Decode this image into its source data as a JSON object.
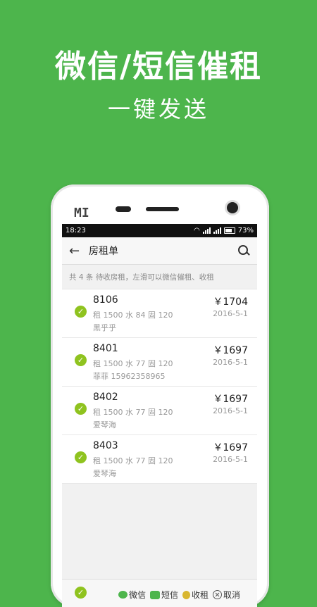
{
  "promo": {
    "headline": "微信/短信催租",
    "subline": "一键发送"
  },
  "phone": {
    "brand_logo": "MI"
  },
  "statusbar": {
    "time": "18:23",
    "battery": "73%"
  },
  "navbar": {
    "back_icon": "back-arrow-icon",
    "title": "房租单",
    "search_icon": "search-icon"
  },
  "summary": "共 4 条 待收房租，左滑可以微信催租、收租",
  "rows": [
    {
      "room": "8106",
      "detail": "租 1500 水 84 固 120",
      "tenant": "黑乎乎",
      "amount": "￥1704",
      "date": "2016-5-1"
    },
    {
      "room": "8401",
      "detail": "租 1500 水 77 固 120",
      "tenant": "菲菲 15962358965",
      "amount": "￥1697",
      "date": "2016-5-1"
    },
    {
      "room": "8402",
      "detail": "租 1500 水 77 固 120",
      "tenant": "爱琴海",
      "amount": "￥1697",
      "date": "2016-5-1"
    },
    {
      "room": "8403",
      "detail": "租 1500 水 77 固 120",
      "tenant": "爱琴海",
      "amount": "￥1697",
      "date": "2016-5-1"
    }
  ],
  "bottombar": {
    "wechat": "微信",
    "sms": "短信",
    "collect": "收租",
    "cancel": "取消"
  },
  "colors": {
    "background": "#4db54c",
    "check": "#8fc31f"
  }
}
